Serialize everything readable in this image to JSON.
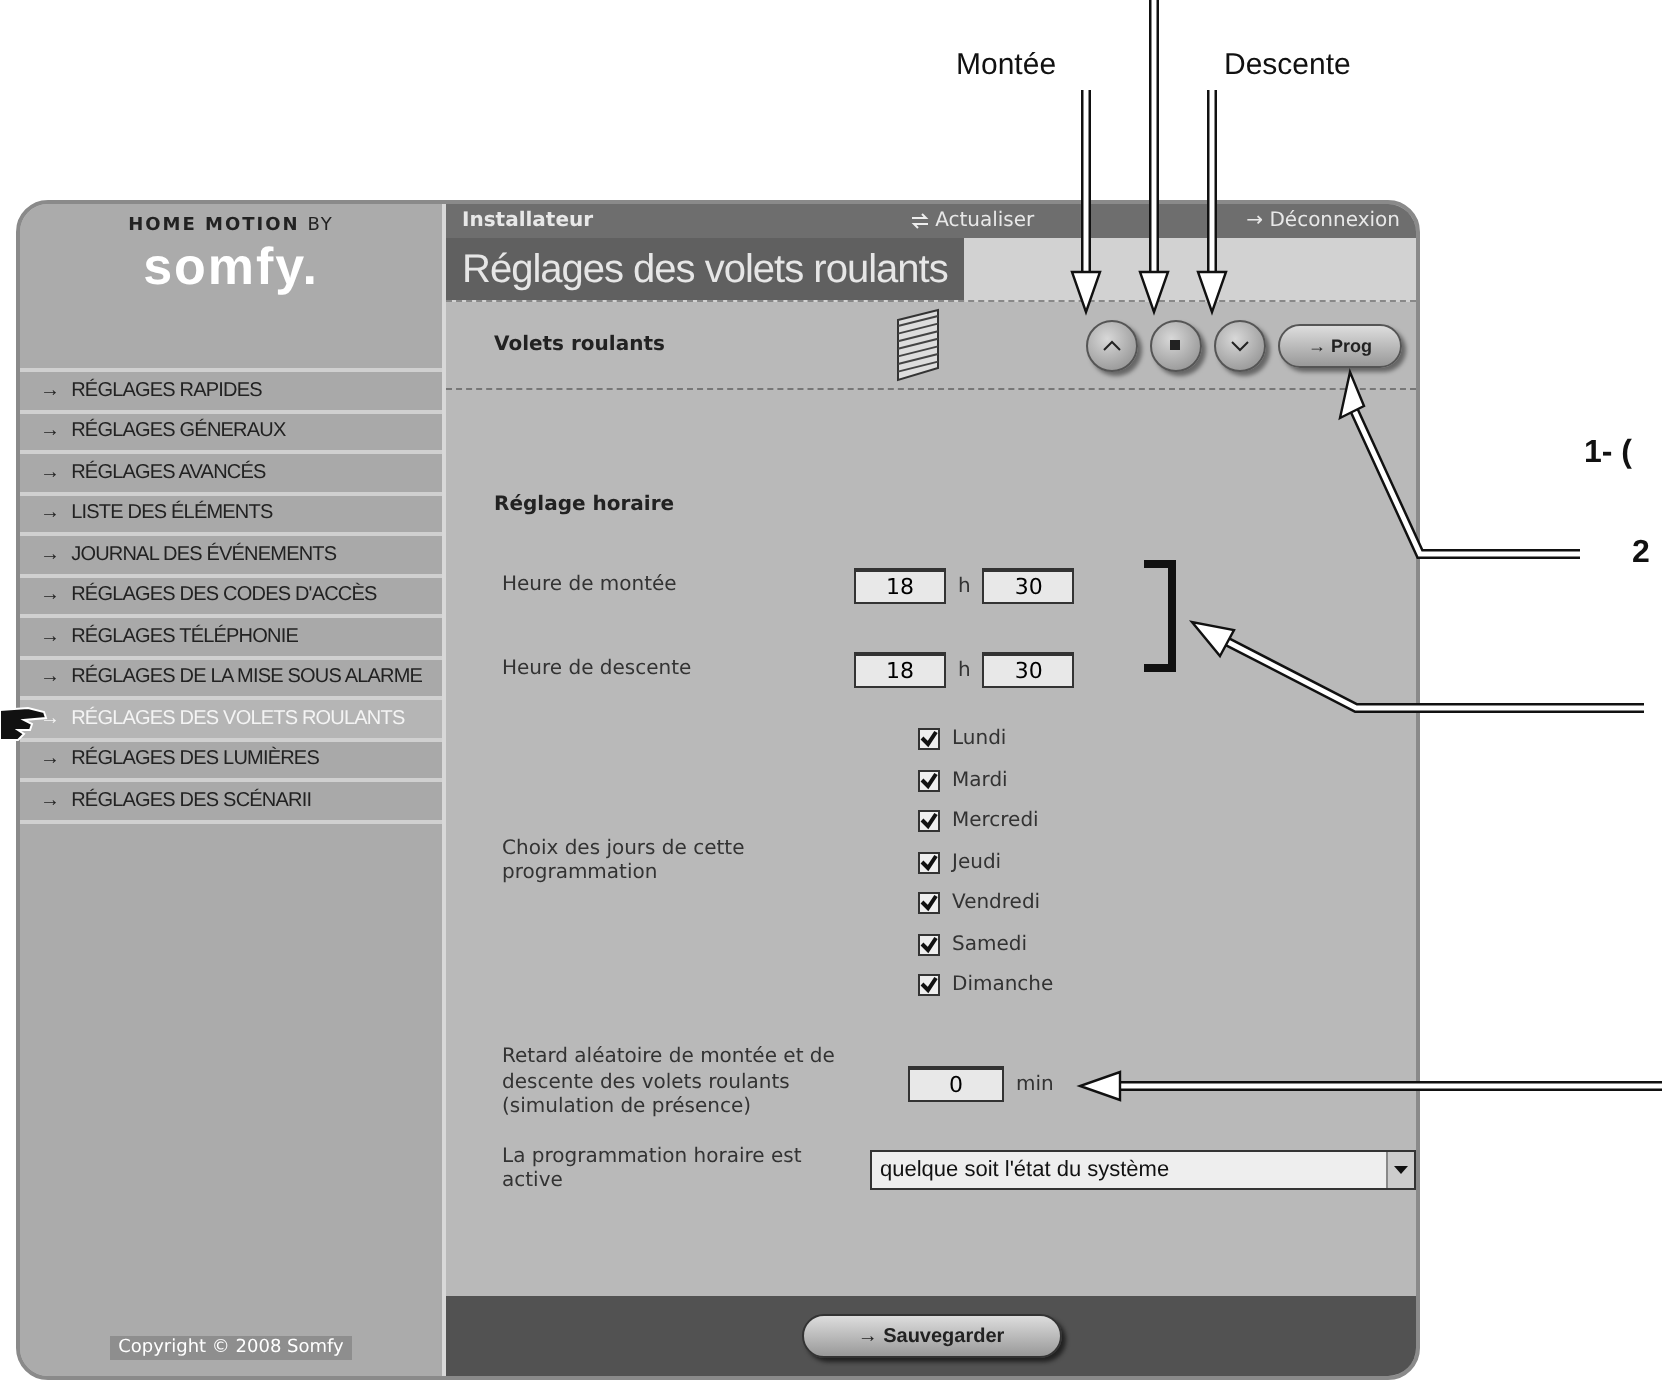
{
  "callouts": [
    "Montée",
    "Descente",
    "1- (",
    "2"
  ],
  "brand": {
    "tagline_bold": "HOME MOTION",
    "tagline_rest": "BY",
    "logo": "somfy."
  },
  "top_bar": {
    "user": "Installateur",
    "refresh": "Actualiser",
    "logout": "→ Déconnexion"
  },
  "page_title": "Réglages des volets roulants",
  "sidebar": {
    "items": [
      {
        "arrow": "→",
        "label": "RÉGLAGES RAPIDES",
        "selected": false
      },
      {
        "arrow": "→",
        "label": "RÉGLAGES GÉNERAUX",
        "selected": false
      },
      {
        "arrow": "→",
        "label": "RÉGLAGES AVANCÉS",
        "selected": false
      },
      {
        "arrow": "→",
        "label": "LISTE DES ÉLÉMENTS",
        "selected": false
      },
      {
        "arrow": "→",
        "label": "JOURNAL DES ÉVÉNEMENTS",
        "selected": false
      },
      {
        "arrow": "→",
        "label": "RÉGLAGES DES CODES D'ACCÈS",
        "selected": false
      },
      {
        "arrow": "→",
        "label": "RÉGLAGES TÉLÉPHONIE",
        "selected": false
      },
      {
        "arrow": "→",
        "label": "RÉGLAGES DE LA MISE SOUS ALARME",
        "selected": false
      },
      {
        "arrow": "→",
        "label": "RÉGLAGES DES VOLETS ROULANTS",
        "selected": true
      },
      {
        "arrow": "→",
        "label": "RÉGLAGES DES LUMIÈRES",
        "selected": false
      },
      {
        "arrow": "→",
        "label": "RÉGLAGES DES SCÉNARII",
        "selected": false
      }
    ],
    "copyright": "Copyright © 2008 Somfy"
  },
  "device": {
    "name": "Volets roulants",
    "prog_button": "→ Prog"
  },
  "schedule": {
    "heading": "Réglage horaire",
    "times": [
      {
        "label": "Heure de montée",
        "hours": "18",
        "sep": "h",
        "minutes": "30"
      },
      {
        "label": "Heure de descente",
        "hours": "18",
        "sep": "h",
        "minutes": "30"
      }
    ],
    "days_label": "Choix des jours de cette programmation",
    "days": [
      {
        "label": "Lundi",
        "checked": true
      },
      {
        "label": "Mardi",
        "checked": true
      },
      {
        "label": "Mercredi",
        "checked": true
      },
      {
        "label": "Jeudi",
        "checked": true
      },
      {
        "label": "Vendredi",
        "checked": true
      },
      {
        "label": "Samedi",
        "checked": true
      },
      {
        "label": "Dimanche",
        "checked": true
      }
    ],
    "delay": {
      "label": "Retard aléatoire de montée et de descente des volets roulants (simulation de présence)",
      "value": "0",
      "unit": "min"
    },
    "active": {
      "label": "La programmation horaire est active",
      "value": "quelque soit l'état du système"
    }
  },
  "save_button": "→ Sauvegarder"
}
